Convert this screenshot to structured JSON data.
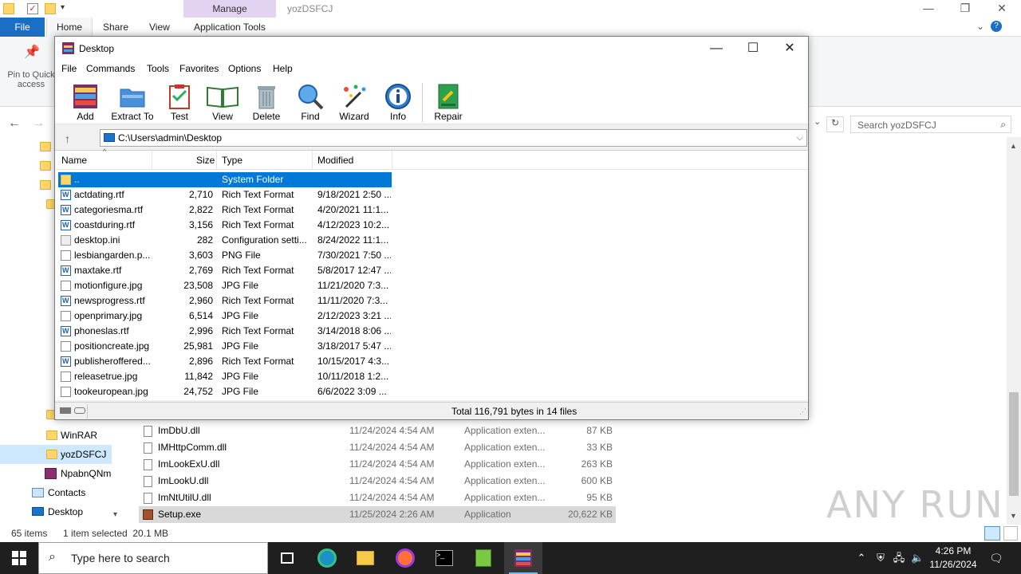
{
  "explorer": {
    "manage_tab": "Manage",
    "window_title": "yozDSFCJ",
    "tabs": {
      "file": "File",
      "home": "Home",
      "share": "Share",
      "view": "View",
      "app_tools": "Application Tools"
    },
    "pin_label": "Pin to Quick access",
    "search_placeholder": "Search yozDSFCJ",
    "nav": {
      "winrar": "WinRAR",
      "yozdsfcj": "yozDSFCJ",
      "npabn": "NpabnQNm",
      "contacts": "Contacts",
      "desktop": "Desktop"
    },
    "files": [
      {
        "name": "ImDbU.dll",
        "date": "11/24/2024 4:54 AM",
        "type": "Application exten...",
        "size": "87 KB"
      },
      {
        "name": "IMHttpComm.dll",
        "date": "11/24/2024 4:54 AM",
        "type": "Application exten...",
        "size": "33 KB"
      },
      {
        "name": "ImLookExU.dll",
        "date": "11/24/2024 4:54 AM",
        "type": "Application exten...",
        "size": "263 KB"
      },
      {
        "name": "ImLookU.dll",
        "date": "11/24/2024 4:54 AM",
        "type": "Application exten...",
        "size": "600 KB"
      },
      {
        "name": "ImNtUtilU.dll",
        "date": "11/24/2024 4:54 AM",
        "type": "Application exten...",
        "size": "95 KB"
      },
      {
        "name": "Setup.exe",
        "date": "11/25/2024 2:26 AM",
        "type": "Application",
        "size": "20,622 KB"
      }
    ],
    "status": {
      "items": "65 items",
      "selected": "1 item selected  20.1 MB"
    },
    "watermark": "ANY RUN"
  },
  "winrar": {
    "title": "Desktop",
    "menu": [
      "File",
      "Commands",
      "Tools",
      "Favorites",
      "Options",
      "Help"
    ],
    "toolbar": {
      "add": "Add",
      "extract": "Extract To",
      "test": "Test",
      "view": "View",
      "delete": "Delete",
      "find": "Find",
      "wizard": "Wizard",
      "info": "Info",
      "repair": "Repair"
    },
    "path": "C:\\Users\\admin\\Desktop",
    "columns": {
      "name": "Name",
      "size": "Size",
      "type": "Type",
      "modified": "Modified"
    },
    "rows": [
      {
        "name": "..",
        "size": "",
        "type": "System Folder",
        "modified": "",
        "icon": "folder"
      },
      {
        "name": "actdating.rtf",
        "size": "2,710",
        "type": "Rich Text Format",
        "modified": "9/18/2021 2:50 ...",
        "icon": "rtf"
      },
      {
        "name": "categoriesma.rtf",
        "size": "2,822",
        "type": "Rich Text Format",
        "modified": "4/20/2021 11:1...",
        "icon": "rtf"
      },
      {
        "name": "coastduring.rtf",
        "size": "3,156",
        "type": "Rich Text Format",
        "modified": "4/12/2023 10:2...",
        "icon": "rtf"
      },
      {
        "name": "desktop.ini",
        "size": "282",
        "type": "Configuration setti...",
        "modified": "8/24/2022 11:1...",
        "icon": "ini"
      },
      {
        "name": "lesbiangarden.p...",
        "size": "3,603",
        "type": "PNG File",
        "modified": "7/30/2021 7:50 ...",
        "icon": "img"
      },
      {
        "name": "maxtake.rtf",
        "size": "2,769",
        "type": "Rich Text Format",
        "modified": "5/8/2017 12:47 ...",
        "icon": "rtf"
      },
      {
        "name": "motionfigure.jpg",
        "size": "23,508",
        "type": "JPG File",
        "modified": "11/21/2020 7:3...",
        "icon": "img"
      },
      {
        "name": "newsprogress.rtf",
        "size": "2,960",
        "type": "Rich Text Format",
        "modified": "11/11/2020 7:3...",
        "icon": "rtf"
      },
      {
        "name": "openprimary.jpg",
        "size": "6,514",
        "type": "JPG File",
        "modified": "2/12/2023 3:21 ...",
        "icon": "img"
      },
      {
        "name": "phoneslas.rtf",
        "size": "2,996",
        "type": "Rich Text Format",
        "modified": "3/14/2018 8:06 ...",
        "icon": "rtf"
      },
      {
        "name": "positioncreate.jpg",
        "size": "25,981",
        "type": "JPG File",
        "modified": "3/18/2017 5:47 ...",
        "icon": "img"
      },
      {
        "name": "publisheroffered...",
        "size": "2,896",
        "type": "Rich Text Format",
        "modified": "10/15/2017 4:3...",
        "icon": "rtf"
      },
      {
        "name": "releasetrue.jpg",
        "size": "11,842",
        "type": "JPG File",
        "modified": "10/11/2018 1:2...",
        "icon": "img"
      },
      {
        "name": "tookeuropean.jpg",
        "size": "24,752",
        "type": "JPG File",
        "modified": "6/6/2022 3:09 ...",
        "icon": "img"
      }
    ],
    "status_total": "Total 116,791 bytes in 14 files"
  },
  "taskbar": {
    "search_placeholder": "Type here to search",
    "time": "4:26 PM",
    "date": "11/26/2024"
  }
}
